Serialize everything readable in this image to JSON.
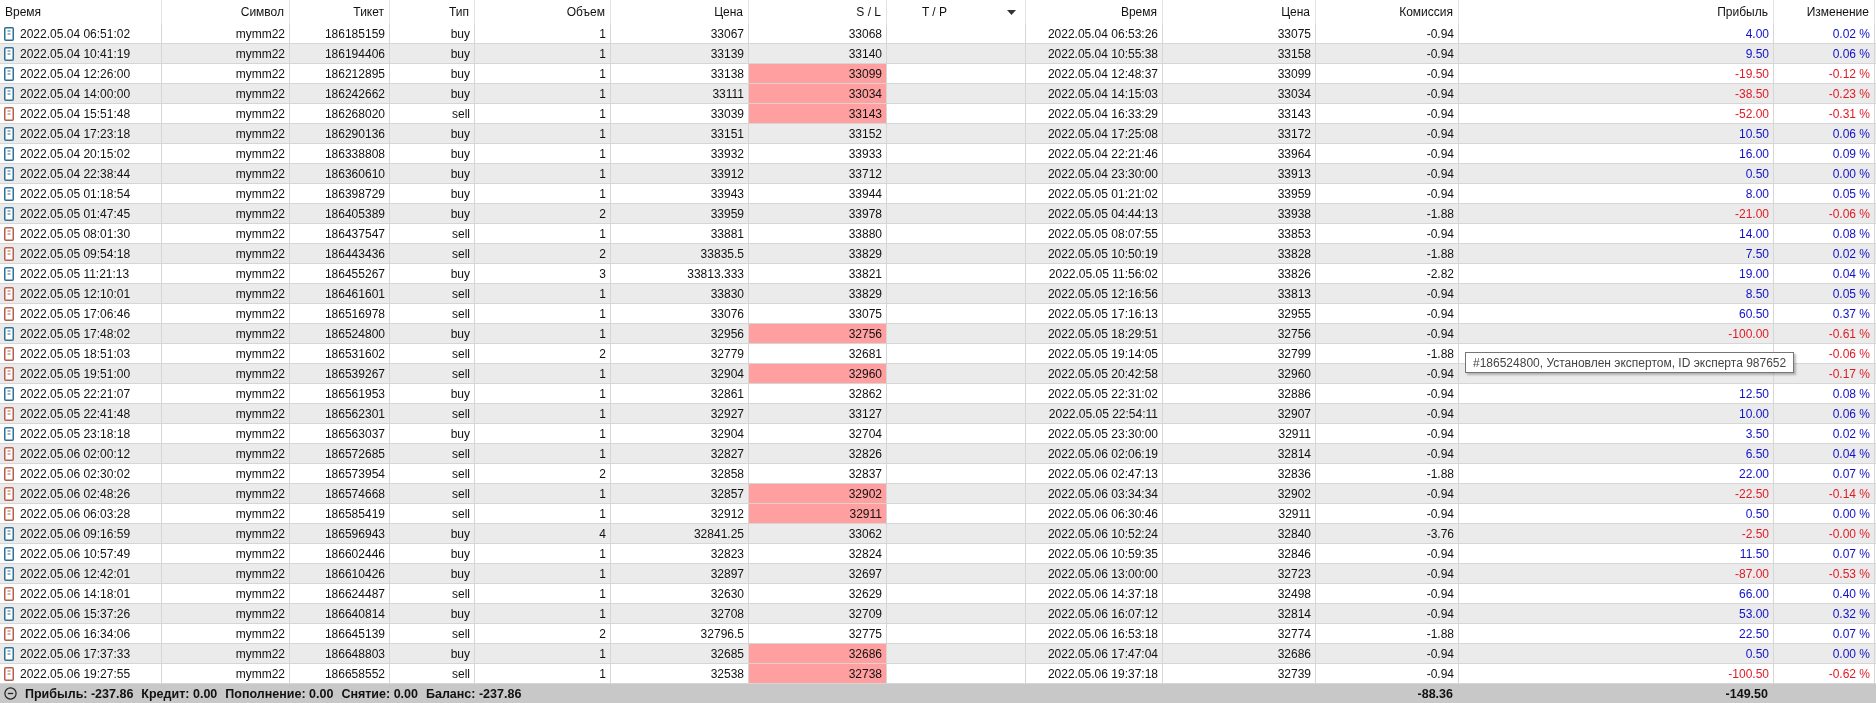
{
  "table": {
    "columns": [
      {
        "label": "Время",
        "sorted": false
      },
      {
        "label": "Символ",
        "sorted": false
      },
      {
        "label": "Тикет",
        "sorted": false
      },
      {
        "label": "Тип",
        "sorted": false
      },
      {
        "label": "Объем",
        "sorted": false
      },
      {
        "label": "Цена",
        "sorted": false
      },
      {
        "label": "S / L",
        "sorted": false
      },
      {
        "label": "T / P",
        "sorted": true
      },
      {
        "label": "Время",
        "sorted": false
      },
      {
        "label": "Цена",
        "sorted": false
      },
      {
        "label": "Комиссия",
        "sorted": false
      },
      {
        "label": "Прибыль",
        "sorted": false
      },
      {
        "label": "Изменение",
        "sorted": false
      }
    ],
    "rows": [
      {
        "kind": "buy",
        "open_time": "2022.05.04 06:51:02",
        "symbol": "mymm22",
        "ticket": "186185159",
        "type": "buy",
        "volume": "1",
        "price": "33067",
        "sl": "33068",
        "sl_hit": false,
        "close_time": "2022.05.04 06:53:26",
        "close_price": "33075",
        "commission": "-0.94",
        "profit": "4.00",
        "loss": false,
        "change": "0.02 %"
      },
      {
        "kind": "buy",
        "open_time": "2022.05.04 10:41:19",
        "symbol": "mymm22",
        "ticket": "186194406",
        "type": "buy",
        "volume": "1",
        "price": "33139",
        "sl": "33140",
        "sl_hit": false,
        "close_time": "2022.05.04 10:55:38",
        "close_price": "33158",
        "commission": "-0.94",
        "profit": "9.50",
        "loss": false,
        "change": "0.06 %"
      },
      {
        "kind": "buy",
        "open_time": "2022.05.04 12:26:00",
        "symbol": "mymm22",
        "ticket": "186212895",
        "type": "buy",
        "volume": "1",
        "price": "33138",
        "sl": "33099",
        "sl_hit": true,
        "close_time": "2022.05.04 12:48:37",
        "close_price": "33099",
        "commission": "-0.94",
        "profit": "-19.50",
        "loss": true,
        "change": "-0.12 %"
      },
      {
        "kind": "buy",
        "open_time": "2022.05.04 14:00:00",
        "symbol": "mymm22",
        "ticket": "186242662",
        "type": "buy",
        "volume": "1",
        "price": "33111",
        "sl": "33034",
        "sl_hit": true,
        "close_time": "2022.05.04 14:15:03",
        "close_price": "33034",
        "commission": "-0.94",
        "profit": "-38.50",
        "loss": true,
        "change": "-0.23 %"
      },
      {
        "kind": "sell",
        "open_time": "2022.05.04 15:51:48",
        "symbol": "mymm22",
        "ticket": "186268020",
        "type": "sell",
        "volume": "1",
        "price": "33039",
        "sl": "33143",
        "sl_hit": true,
        "close_time": "2022.05.04 16:33:29",
        "close_price": "33143",
        "commission": "-0.94",
        "profit": "-52.00",
        "loss": true,
        "change": "-0.31 %"
      },
      {
        "kind": "buy",
        "open_time": "2022.05.04 17:23:18",
        "symbol": "mymm22",
        "ticket": "186290136",
        "type": "buy",
        "volume": "1",
        "price": "33151",
        "sl": "33152",
        "sl_hit": false,
        "close_time": "2022.05.04 17:25:08",
        "close_price": "33172",
        "commission": "-0.94",
        "profit": "10.50",
        "loss": false,
        "change": "0.06 %"
      },
      {
        "kind": "buy",
        "open_time": "2022.05.04 20:15:02",
        "symbol": "mymm22",
        "ticket": "186338808",
        "type": "buy",
        "volume": "1",
        "price": "33932",
        "sl": "33933",
        "sl_hit": false,
        "close_time": "2022.05.04 22:21:46",
        "close_price": "33964",
        "commission": "-0.94",
        "profit": "16.00",
        "loss": false,
        "change": "0.09 %"
      },
      {
        "kind": "buy",
        "open_time": "2022.05.04 22:38:44",
        "symbol": "mymm22",
        "ticket": "186360610",
        "type": "buy",
        "volume": "1",
        "price": "33912",
        "sl": "33712",
        "sl_hit": false,
        "close_time": "2022.05.04 23:30:00",
        "close_price": "33913",
        "commission": "-0.94",
        "profit": "0.50",
        "loss": false,
        "change": "0.00 %"
      },
      {
        "kind": "buy",
        "open_time": "2022.05.05 01:18:54",
        "symbol": "mymm22",
        "ticket": "186398729",
        "type": "buy",
        "volume": "1",
        "price": "33943",
        "sl": "33944",
        "sl_hit": false,
        "close_time": "2022.05.05 01:21:02",
        "close_price": "33959",
        "commission": "-0.94",
        "profit": "8.00",
        "loss": false,
        "change": "0.05 %"
      },
      {
        "kind": "buy",
        "open_time": "2022.05.05 01:47:45",
        "symbol": "mymm22",
        "ticket": "186405389",
        "type": "buy",
        "volume": "2",
        "price": "33959",
        "sl": "33978",
        "sl_hit": false,
        "close_time": "2022.05.05 04:44:13",
        "close_price": "33938",
        "commission": "-1.88",
        "profit": "-21.00",
        "loss": true,
        "change": "-0.06 %"
      },
      {
        "kind": "sell",
        "open_time": "2022.05.05 08:01:30",
        "symbol": "mymm22",
        "ticket": "186437547",
        "type": "sell",
        "volume": "1",
        "price": "33881",
        "sl": "33880",
        "sl_hit": false,
        "close_time": "2022.05.05 08:07:55",
        "close_price": "33853",
        "commission": "-0.94",
        "profit": "14.00",
        "loss": false,
        "change": "0.08 %"
      },
      {
        "kind": "sell",
        "open_time": "2022.05.05 09:54:18",
        "symbol": "mymm22",
        "ticket": "186443436",
        "type": "sell",
        "volume": "2",
        "price": "33835.5",
        "sl": "33829",
        "sl_hit": false,
        "close_time": "2022.05.05 10:50:19",
        "close_price": "33828",
        "commission": "-1.88",
        "profit": "7.50",
        "loss": false,
        "change": "0.02 %"
      },
      {
        "kind": "buy",
        "open_time": "2022.05.05 11:21:13",
        "symbol": "mymm22",
        "ticket": "186455267",
        "type": "buy",
        "volume": "3",
        "price": "33813.333",
        "sl": "33821",
        "sl_hit": false,
        "close_time": "2022.05.05 11:56:02",
        "close_price": "33826",
        "commission": "-2.82",
        "profit": "19.00",
        "loss": false,
        "change": "0.04 %"
      },
      {
        "kind": "sell",
        "open_time": "2022.05.05 12:10:01",
        "symbol": "mymm22",
        "ticket": "186461601",
        "type": "sell",
        "volume": "1",
        "price": "33830",
        "sl": "33829",
        "sl_hit": false,
        "close_time": "2022.05.05 12:16:56",
        "close_price": "33813",
        "commission": "-0.94",
        "profit": "8.50",
        "loss": false,
        "change": "0.05 %"
      },
      {
        "kind": "sell",
        "open_time": "2022.05.05 17:06:46",
        "symbol": "mymm22",
        "ticket": "186516978",
        "type": "sell",
        "volume": "1",
        "price": "33076",
        "sl": "33075",
        "sl_hit": false,
        "close_time": "2022.05.05 17:16:13",
        "close_price": "32955",
        "commission": "-0.94",
        "profit": "60.50",
        "loss": false,
        "change": "0.37 %"
      },
      {
        "kind": "buy",
        "open_time": "2022.05.05 17:48:02",
        "symbol": "mymm22",
        "ticket": "186524800",
        "type": "buy",
        "volume": "1",
        "price": "32956",
        "sl": "32756",
        "sl_hit": true,
        "close_time": "2022.05.05 18:29:51",
        "close_price": "32756",
        "commission": "-0.94",
        "profit": "-100.00",
        "loss": true,
        "change": "-0.61 %"
      },
      {
        "kind": "sell",
        "open_time": "2022.05.05 18:51:03",
        "symbol": "mymm22",
        "ticket": "186531602",
        "type": "sell",
        "volume": "2",
        "price": "32779",
        "sl": "32681",
        "sl_hit": false,
        "close_time": "2022.05.05 19:14:05",
        "close_price": "32799",
        "commission": "-1.88",
        "loss": true,
        "change": "-0.06 %"
      },
      {
        "kind": "sell",
        "open_time": "2022.05.05 19:51:00",
        "symbol": "mymm22",
        "ticket": "186539267",
        "type": "sell",
        "volume": "1",
        "price": "32904",
        "sl": "32960",
        "sl_hit": true,
        "close_time": "2022.05.05 20:42:58",
        "close_price": "32960",
        "commission": "-0.94",
        "loss": true,
        "change": "-0.17 %"
      },
      {
        "kind": "buy",
        "open_time": "2022.05.05 22:21:07",
        "symbol": "mymm22",
        "ticket": "186561953",
        "type": "buy",
        "volume": "1",
        "price": "32861",
        "sl": "32862",
        "sl_hit": false,
        "close_time": "2022.05.05 22:31:02",
        "close_price": "32886",
        "commission": "-0.94",
        "profit": "12.50",
        "loss": false,
        "change": "0.08 %"
      },
      {
        "kind": "sell",
        "open_time": "2022.05.05 22:41:48",
        "symbol": "mymm22",
        "ticket": "186562301",
        "type": "sell",
        "volume": "1",
        "price": "32927",
        "sl": "33127",
        "sl_hit": false,
        "close_time": "2022.05.05 22:54:11",
        "close_price": "32907",
        "commission": "-0.94",
        "profit": "10.00",
        "loss": false,
        "change": "0.06 %"
      },
      {
        "kind": "buy",
        "open_time": "2022.05.05 23:18:18",
        "symbol": "mymm22",
        "ticket": "186563037",
        "type": "buy",
        "volume": "1",
        "price": "32904",
        "sl": "32704",
        "sl_hit": false,
        "close_time": "2022.05.05 23:30:00",
        "close_price": "32911",
        "commission": "-0.94",
        "profit": "3.50",
        "loss": false,
        "change": "0.02 %"
      },
      {
        "kind": "sell",
        "open_time": "2022.05.06 02:00:12",
        "symbol": "mymm22",
        "ticket": "186572685",
        "type": "sell",
        "volume": "1",
        "price": "32827",
        "sl": "32826",
        "sl_hit": false,
        "close_time": "2022.05.06 02:06:19",
        "close_price": "32814",
        "commission": "-0.94",
        "profit": "6.50",
        "loss": false,
        "change": "0.04 %"
      },
      {
        "kind": "sell",
        "open_time": "2022.05.06 02:30:02",
        "symbol": "mymm22",
        "ticket": "186573954",
        "type": "sell",
        "volume": "2",
        "price": "32858",
        "sl": "32837",
        "sl_hit": false,
        "close_time": "2022.05.06 02:47:13",
        "close_price": "32836",
        "commission": "-1.88",
        "profit": "22.00",
        "loss": false,
        "change": "0.07 %"
      },
      {
        "kind": "sell",
        "open_time": "2022.05.06 02:48:26",
        "symbol": "mymm22",
        "ticket": "186574668",
        "type": "sell",
        "volume": "1",
        "price": "32857",
        "sl": "32902",
        "sl_hit": true,
        "close_time": "2022.05.06 03:34:34",
        "close_price": "32902",
        "commission": "-0.94",
        "profit": "-22.50",
        "loss": true,
        "change": "-0.14 %"
      },
      {
        "kind": "sell",
        "open_time": "2022.05.06 06:03:28",
        "symbol": "mymm22",
        "ticket": "186585419",
        "type": "sell",
        "volume": "1",
        "price": "32912",
        "sl": "32911",
        "sl_hit": true,
        "close_time": "2022.05.06 06:30:46",
        "close_price": "32911",
        "commission": "-0.94",
        "profit": "0.50",
        "loss": false,
        "change": "0.00 %"
      },
      {
        "kind": "buy",
        "open_time": "2022.05.06 09:16:59",
        "symbol": "mymm22",
        "ticket": "186596943",
        "type": "buy",
        "volume": "4",
        "price": "32841.25",
        "sl": "33062",
        "sl_hit": false,
        "close_time": "2022.05.06 10:52:24",
        "close_price": "32840",
        "commission": "-3.76",
        "profit": "-2.50",
        "loss": true,
        "change": "-0.00 %"
      },
      {
        "kind": "buy",
        "open_time": "2022.05.06 10:57:49",
        "symbol": "mymm22",
        "ticket": "186602446",
        "type": "buy",
        "volume": "1",
        "price": "32823",
        "sl": "32824",
        "sl_hit": false,
        "close_time": "2022.05.06 10:59:35",
        "close_price": "32846",
        "commission": "-0.94",
        "profit": "11.50",
        "loss": false,
        "change": "0.07 %"
      },
      {
        "kind": "buy",
        "open_time": "2022.05.06 12:42:01",
        "symbol": "mymm22",
        "ticket": "186610426",
        "type": "buy",
        "volume": "1",
        "price": "32897",
        "sl": "32697",
        "sl_hit": false,
        "close_time": "2022.05.06 13:00:00",
        "close_price": "32723",
        "commission": "-0.94",
        "profit": "-87.00",
        "loss": true,
        "change": "-0.53 %"
      },
      {
        "kind": "sell",
        "open_time": "2022.05.06 14:18:01",
        "symbol": "mymm22",
        "ticket": "186624487",
        "type": "sell",
        "volume": "1",
        "price": "32630",
        "sl": "32629",
        "sl_hit": false,
        "close_time": "2022.05.06 14:37:18",
        "close_price": "32498",
        "commission": "-0.94",
        "profit": "66.00",
        "loss": false,
        "change": "0.40 %"
      },
      {
        "kind": "buy",
        "open_time": "2022.05.06 15:37:26",
        "symbol": "mymm22",
        "ticket": "186640814",
        "type": "buy",
        "volume": "1",
        "price": "32708",
        "sl": "32709",
        "sl_hit": false,
        "close_time": "2022.05.06 16:07:12",
        "close_price": "32814",
        "commission": "-0.94",
        "profit": "53.00",
        "loss": false,
        "change": "0.32 %"
      },
      {
        "kind": "sell",
        "open_time": "2022.05.06 16:34:06",
        "symbol": "mymm22",
        "ticket": "186645139",
        "type": "sell",
        "volume": "2",
        "price": "32796.5",
        "sl": "32775",
        "sl_hit": false,
        "close_time": "2022.05.06 16:53:18",
        "close_price": "32774",
        "commission": "-1.88",
        "profit": "22.50",
        "loss": false,
        "change": "0.07 %"
      },
      {
        "kind": "buy",
        "open_time": "2022.05.06 17:37:33",
        "symbol": "mymm22",
        "ticket": "186648803",
        "type": "buy",
        "volume": "1",
        "price": "32685",
        "sl": "32686",
        "sl_hit": true,
        "close_time": "2022.05.06 17:47:04",
        "close_price": "32686",
        "commission": "-0.94",
        "profit": "0.50",
        "loss": false,
        "change": "0.00 %"
      },
      {
        "kind": "sell",
        "open_time": "2022.05.06 19:27:55",
        "symbol": "mymm22",
        "ticket": "186658552",
        "type": "sell",
        "volume": "1",
        "price": "32538",
        "sl": "32738",
        "sl_hit": true,
        "close_time": "2022.05.06 19:37:18",
        "close_price": "32739",
        "commission": "-0.94",
        "profit": "-100.50",
        "loss": true,
        "change": "-0.62 %"
      }
    ]
  },
  "summary": {
    "items": [
      "Прибыль: -237.86",
      "Кредит: 0.00",
      "Пополнение: 0.00",
      "Снятие: 0.00",
      "Баланс: -237.86"
    ],
    "commission": "-88.36",
    "profit": "-149.50"
  },
  "tooltip": {
    "text": "#186524800, Установлен экспертом, ID эксперта 987652"
  }
}
